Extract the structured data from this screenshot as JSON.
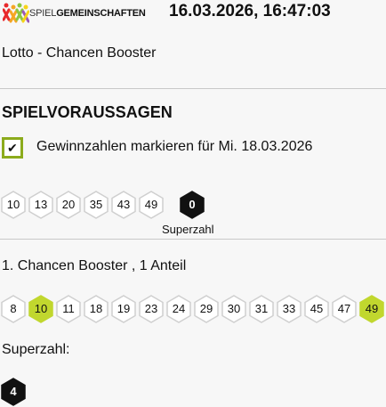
{
  "header": {
    "logo_text_light": "SPIEL",
    "logo_text_bold": "GEMEINSCHAFTEN",
    "logo_colors": [
      "#e8282b",
      "#f5a623",
      "#8cc63f",
      "#f7d417",
      "#9b59b6"
    ],
    "datetime": "16.03.2026, 16:47:03"
  },
  "subtitle": "Lotto - Chancen Booster",
  "section_title": "SPIELVORAUSSAGEN",
  "checkbox": {
    "checked": true,
    "label": "Gewinnzahlen markieren für Mi. 18.03.2026"
  },
  "prediction": {
    "numbers": [
      "10",
      "13",
      "20",
      "35",
      "43",
      "49"
    ],
    "superzahl": "0",
    "superzahl_label": "Superzahl"
  },
  "tip": {
    "title": "1. Chancen Booster , 1 Anteil",
    "numbers": [
      {
        "value": "8",
        "hit": false
      },
      {
        "value": "10",
        "hit": true
      },
      {
        "value": "11",
        "hit": false
      },
      {
        "value": "18",
        "hit": false
      },
      {
        "value": "19",
        "hit": false
      },
      {
        "value": "23",
        "hit": false
      },
      {
        "value": "24",
        "hit": false
      },
      {
        "value": "29",
        "hit": false
      },
      {
        "value": "30",
        "hit": false
      },
      {
        "value": "31",
        "hit": false
      },
      {
        "value": "33",
        "hit": false
      },
      {
        "value": "45",
        "hit": false
      },
      {
        "value": "47",
        "hit": false
      },
      {
        "value": "49",
        "hit": true
      }
    ],
    "superzahl_title": "Superzahl:",
    "superzahl": "4"
  },
  "colors": {
    "hit_fill": "#c1d72e",
    "hex_border": "#cfcfcf",
    "dark_fill": "#111111",
    "checkbox_border": "#8cab1c"
  }
}
